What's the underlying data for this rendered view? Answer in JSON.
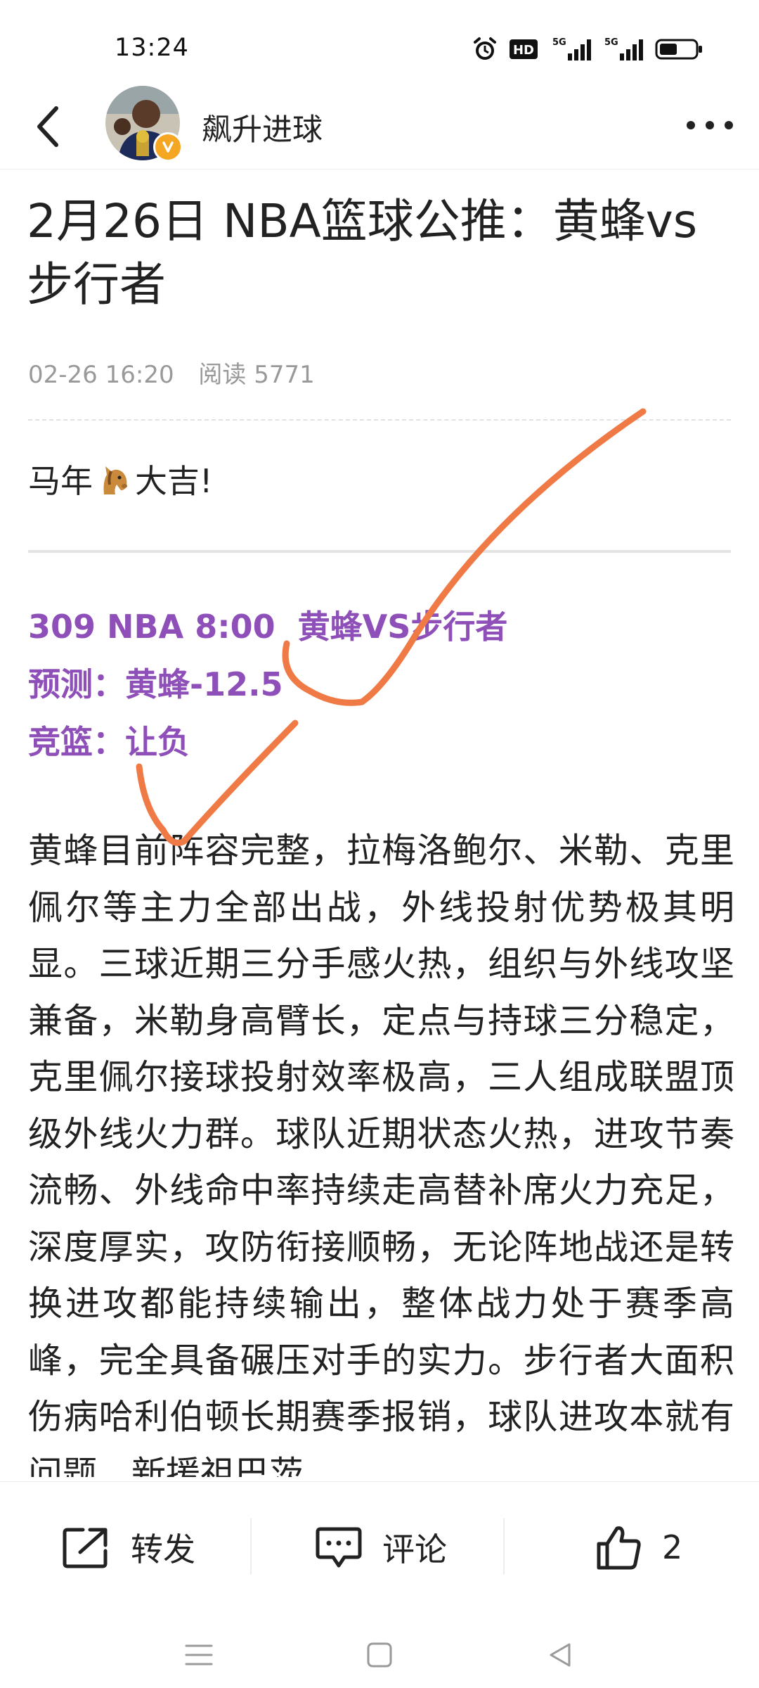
{
  "status_bar": {
    "time": "13:24",
    "icons": [
      "alarm-icon",
      "hd-icon",
      "signal-5g-icon",
      "signal-5g-icon",
      "battery-icon"
    ],
    "hd_label": "HD",
    "net_label_1": "5G",
    "net_label_2": "5G"
  },
  "header": {
    "author": "飙升进球",
    "back_icon": "chevron-left-icon",
    "more_icon": "more-dots-icon"
  },
  "article": {
    "title": "2月26日 NBA篮球公推：黄蜂vs步行者",
    "date": "02-26 16:20",
    "reads": "阅读 5771",
    "greeting_before": "马年",
    "greeting_after": "大吉!",
    "pick_line_1": "309 NBA 8:00  黄蜂VS步行者",
    "pick_line_2": "预测：黄蜂-12.5",
    "pick_line_3": "竞篮：让负",
    "body": "黄蜂目前阵容完整，拉梅洛鲍尔、米勒、克里佩尔等主力全部出战，外线投射优势极其明显。三球近期三分手感火热，组织与外线攻坚兼备，米勒身高臂长，定点与持球三分稳定，克里佩尔接球投射效率极高，三人组成联盟顶级外线火力群。球队近期状态火热，进攻节奏流畅、外线命中率持续走高替补席火力充足，深度厚实，攻防衔接顺畅，无论阵地战还是转换进攻都能持续输出，整体战力处于赛季高峰，完全具备碾压对手的实力。步行者大面积伤病哈利伯顿长期赛季报销，球队进攻本就有问题，新援祖巴茨"
  },
  "actions": {
    "repost": "转发",
    "comment": "评论",
    "like_count": "2"
  },
  "colors": {
    "accent_purple": "#8e4fb8",
    "annotation_orange": "#f07a45",
    "verified_badge": "#f5a623"
  }
}
